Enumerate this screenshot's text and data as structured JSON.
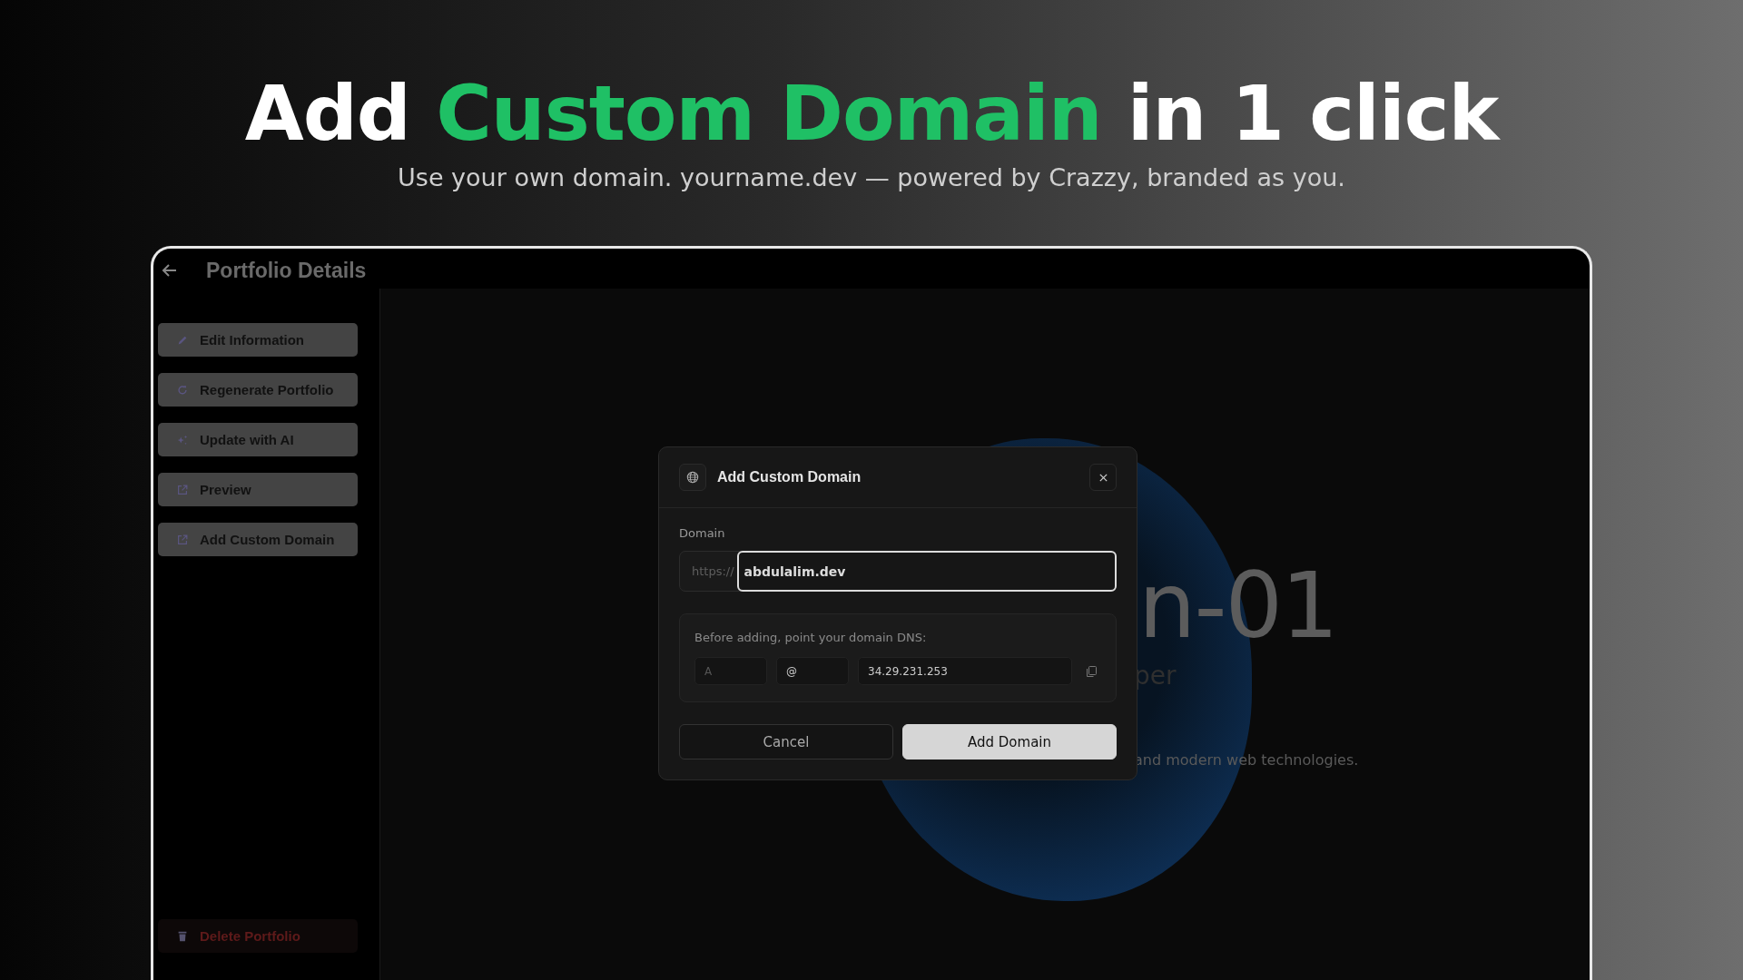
{
  "headline": [
    {
      "text": "Add ",
      "highlight": false
    },
    {
      "text": "Custom Domain",
      "highlight": true
    },
    {
      "text": " in 1 click",
      "highlight": false
    }
  ],
  "subtitle": "Use your own domain. yourname.dev — powered by Crazzy, branded as you.",
  "app": {
    "title": "Portfolio Details",
    "sidebar": [
      {
        "label": "Edit Information",
        "kind": "action"
      },
      {
        "label": "Regenerate Portfolio",
        "kind": "action"
      },
      {
        "label": "Update with AI",
        "kind": "action"
      },
      {
        "label": "Preview",
        "kind": "action"
      },
      {
        "label": "Add Custom Domain",
        "kind": "action"
      },
      {
        "label": "Delete Portfolio",
        "kind": "danger"
      }
    ],
    "preview": {
      "heading": "n-01",
      "subheading": "per",
      "tagline": "and modern web technologies."
    },
    "dialog": {
      "title": "Add Custom Domain",
      "domain_label": "Domain",
      "prefix": "https://",
      "domain_value": "abdulalim.dev",
      "dns_hint": "Before adding, point your domain DNS:",
      "dns_record": {
        "type": "A",
        "name": "@",
        "value": "34.29.231.253"
      },
      "buttons": [
        {
          "label": "Cancel",
          "kind": "secondary"
        },
        {
          "label": "Add Domain",
          "kind": "primary"
        }
      ]
    }
  }
}
